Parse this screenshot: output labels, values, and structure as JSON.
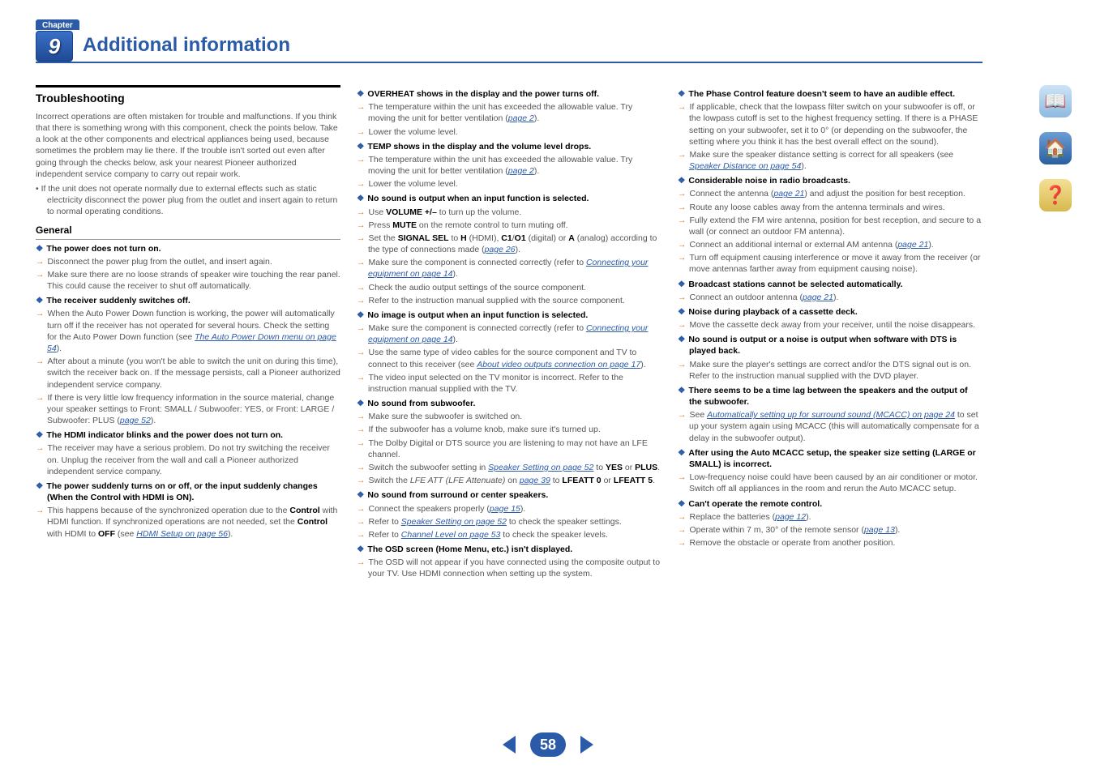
{
  "chapter_label": "Chapter",
  "chapter_number": "9",
  "page_title": "Additional information",
  "page_number": "58",
  "side": {
    "toc": "📖",
    "home": "🏠",
    "help": "❓"
  },
  "col1": {
    "section": "Troubleshooting",
    "intro": "Incorrect operations are often mistaken for trouble and malfunctions. If you think that there is something wrong with this component, check the points below. Take a look at the other components and electrical appliances being used, because sometimes the problem may lie there. If the trouble isn't sorted out even after going through the checks below, ask your nearest Pioneer authorized independent service company to carry out repair work.",
    "bullet1": "• If the unit does not operate normally due to external effects such as static electricity disconnect the power plug from the outlet and insert again to return to normal operating conditions.",
    "sub": "General",
    "d1": "The power does not turn on.",
    "a1": "Disconnect the power plug from the outlet, and insert again.",
    "a2": "Make sure there are no loose strands of speaker wire touching the rear panel. This could cause the receiver to shut off automatically.",
    "d2": "The receiver suddenly switches off.",
    "a3_pre": "When the Auto Power Down function is working, the power will automatically turn off if the receiver has not operated for several hours. Check the setting for the Auto Power Down function (see ",
    "a3_link": "The Auto Power Down menu on page 54",
    "a3_post": ").",
    "a4": "After about a minute (you won't be able to switch the unit on during this time), switch the receiver back on. If the message persists, call a Pioneer authorized independent service company.",
    "a5_pre": "If there is very little low frequency information in the source material, change your speaker settings to Front: SMALL / Subwoofer: YES, or Front: LARGE / Subwoofer: PLUS (",
    "a5_link": "page 52",
    "a5_post": ").",
    "d3": "The HDMI indicator blinks and the power does not turn on.",
    "a6": "The receiver may have a serious problem. Do not try switching the receiver on. Unplug the receiver from the wall and call a Pioneer authorized independent service company.",
    "d4": "The power suddenly turns on or off, or the input suddenly changes (When the Control with HDMI is ON).",
    "a7_pre": "This happens because of the synchronized operation due to the ",
    "a7_b1": "Control",
    "a7_mid1": " with HDMI function. If synchronized operations are not needed, set the ",
    "a7_b2": "Control",
    "a7_mid2": " with HDMI to ",
    "a7_b3": "OFF",
    "a7_mid3": " (see ",
    "a7_link": "HDMI Setup on page 56",
    "a7_post": ")."
  },
  "col2": {
    "d1": "OVERHEAT shows in the display and the power turns off.",
    "a1_pre": "The temperature within the unit has exceeded the allowable value. Try moving the unit for better ventilation (",
    "a1_link": "page 2",
    "a1_post": ").",
    "a2": "Lower the volume level.",
    "d2": "TEMP shows in the display and the volume level drops.",
    "a3_pre": "The temperature within the unit has exceeded the allowable value. Try moving the unit for better ventilation (",
    "a3_link": "page 2",
    "a3_post": ").",
    "a4": "Lower the volume level.",
    "d3": "No sound is output when an input function is selected.",
    "a5_pre": "Use ",
    "a5_b": "VOLUME +/–",
    "a5_post": " to turn up the volume.",
    "a6_pre": "Press ",
    "a6_b": "MUTE",
    "a6_post": " on the remote control to turn muting off.",
    "a7_pre": "Set the ",
    "a7_b1": "SIGNAL SEL",
    "a7_mid1": " to ",
    "a7_b2": "H",
    "a7_mid2": " (HDMI), ",
    "a7_b3": "C1",
    "a7_mid3": "/",
    "a7_b4": "O1",
    "a7_mid4": " (digital) or ",
    "a7_b5": "A",
    "a7_mid5": " (analog) according to the type of connections made (",
    "a7_link": "page 26",
    "a7_post": ").",
    "a8_pre": "Make sure the component is connected correctly (refer to ",
    "a8_link": "Connecting your equipment on page 14",
    "a8_post": ").",
    "a9": "Check the audio output settings of the source component.",
    "a10": "Refer to the instruction manual supplied with the source component.",
    "d4": "No image is output when an input function is selected.",
    "a11_pre": "Make sure the component is connected correctly (refer to ",
    "a11_link": "Connecting your equipment on page 14",
    "a11_post": ").",
    "a12_pre": "Use the same type of video cables for the source component and TV to connect to this receiver (see ",
    "a12_link": "About video outputs connection on page 17",
    "a12_post": ").",
    "a13": "The video input selected on the TV monitor is incorrect. Refer to the instruction manual supplied with the TV.",
    "d5": "No sound from subwoofer.",
    "a14": "Make sure the subwoofer is switched on.",
    "a15": "If the subwoofer has a volume knob, make sure it's turned up.",
    "a16": "The Dolby Digital or DTS source you are listening to may not have an LFE channel.",
    "a17_pre": "Switch the subwoofer setting in ",
    "a17_link": "Speaker Setting on page 52",
    "a17_mid": " to ",
    "a17_b1": "YES",
    "a17_or": " or ",
    "a17_b2": "PLUS",
    "a17_post": ".",
    "a18_pre": "Switch the ",
    "a18_i": "LFE ATT (LFE Attenuate)",
    "a18_mid": " on ",
    "a18_link": "page 39",
    "a18_mid2": " to ",
    "a18_b1": "LFEATT 0",
    "a18_or": " or ",
    "a18_b2": "LFEATT 5",
    "a18_post": ".",
    "d6": "No sound from surround or center speakers.",
    "a19_pre": "Connect the speakers properly (",
    "a19_link": "page 15",
    "a19_post": ").",
    "a20_pre": "Refer to ",
    "a20_link": "Speaker Setting on page 52",
    "a20_post": " to check the speaker settings.",
    "a21_pre": "Refer to ",
    "a21_link": "Channel Level on page 53",
    "a21_post": " to check the speaker levels.",
    "d7": "The OSD screen (Home Menu, etc.) isn't displayed.",
    "a22": "The OSD will not appear if you have connected using the composite output to your TV. Use HDMI connection when setting up the system."
  },
  "col3": {
    "d1": "The Phase Control feature doesn't seem to have an audible effect.",
    "a1": "If applicable, check that the lowpass filter switch on your subwoofer is off, or the lowpass cutoff is set to the highest frequency setting. If there is a PHASE setting on your subwoofer, set it to 0° (or depending on the subwoofer, the setting where you think it has the best overall effect on the sound).",
    "a2_pre": "Make sure the speaker distance setting is correct for all speakers (see ",
    "a2_link": "Speaker Distance on page 54",
    "a2_post": ").",
    "d2": "Considerable noise in radio broadcasts.",
    "a3_pre": "Connect the antenna (",
    "a3_link": "page 21",
    "a3_post": ") and adjust the position for best reception.",
    "a4": "Route any loose cables away from the antenna terminals and wires.",
    "a5": "Fully extend the FM wire antenna, position for best reception, and secure to a wall (or connect an outdoor FM antenna).",
    "a6_pre": "Connect an additional internal or external AM antenna (",
    "a6_link": "page 21",
    "a6_post": ").",
    "a7": "Turn off equipment causing interference or move it away from the receiver (or move antennas farther away from equipment causing noise).",
    "d3": "Broadcast stations cannot be selected automatically.",
    "a8_pre": "Connect an outdoor antenna (",
    "a8_link": "page 21",
    "a8_post": ").",
    "d4": "Noise during playback of a cassette deck.",
    "a9": "Move the cassette deck away from your receiver, until the noise disappears.",
    "d5": "No sound is output or a noise is output when software with DTS is played back.",
    "a10": "Make sure the player's settings are correct and/or the DTS signal out is on. Refer to the instruction manual supplied with the DVD player.",
    "d6": "There seems to be a time lag between the speakers and the output of the subwoofer.",
    "a11_pre": "See ",
    "a11_link": "Automatically setting up for surround sound (MCACC) on page 24",
    "a11_post": " to set up your system again using MCACC (this will automatically compensate for a delay in the subwoofer output).",
    "d7": "After using the Auto MCACC setup, the speaker size setting (LARGE or SMALL) is incorrect.",
    "a12": "Low-frequency noise could have been caused by an air conditioner or motor. Switch off all appliances in the room and rerun the Auto MCACC setup.",
    "d8": "Can't operate the remote control.",
    "a13_pre": "Replace the batteries (",
    "a13_link": "page 12",
    "a13_post": ").",
    "a14_pre": "Operate within 7 m, 30° of the remote sensor (",
    "a14_link": "page 13",
    "a14_post": ").",
    "a15": "Remove the obstacle or operate from another position."
  }
}
